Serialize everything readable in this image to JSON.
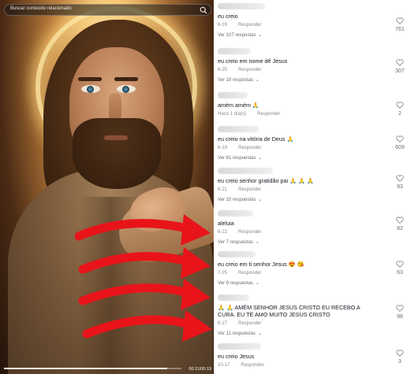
{
  "search": {
    "placeholder": "Buscar conteúdo relacionado"
  },
  "video": {
    "time": "00:11/00:19",
    "progress_fraction": 0.92
  },
  "comments": [
    {
      "text": "eu creio",
      "date": "6-19",
      "reply": "Responder",
      "likes": "761",
      "views": "Ver 107 respostas"
    },
    {
      "text": "eu creio em nome dê Jesus",
      "date": "6-25",
      "reply": "Responder",
      "likes": "307",
      "views": "Ver 18 respostas"
    },
    {
      "text": "amém amém 🙏",
      "date": "Hace 1 día(s)",
      "reply": "Responder",
      "likes": "2",
      "views": ""
    },
    {
      "text": "eu creio na vitória de Deus 🙏",
      "date": "6-19",
      "reply": "Responder",
      "likes": "609",
      "views": "Ver 61 respuestas"
    },
    {
      "text": "eu creio senhor gratidão pai 🙏 🙏 🙏",
      "date": "6-21",
      "reply": "Responder",
      "likes": "93",
      "views": "Ver 10 respuestas"
    },
    {
      "text": "aleluia",
      "date": "6-22",
      "reply": "Responder",
      "likes": "82",
      "views": "Ver 7 respuestas"
    },
    {
      "text": "eu creio em ti senhor Jesus 😍 😘",
      "date": "7-25",
      "reply": "Responder",
      "likes": "63",
      "views": "Ver 9 respuestas"
    },
    {
      "text": "🙏 🙏 AMÉM SENHOR JESUS CRISTO EU RECEBO A CURA. EU TE AMO MUITO JESUS CRISTO",
      "date": "6-17",
      "reply": "Responder",
      "likes": "98",
      "views": "Ver 11 respuestas"
    },
    {
      "text": "eu creio Jesus",
      "date": "10-17",
      "reply": "Responder",
      "likes": "3",
      "views": ""
    }
  ],
  "icons": {
    "search": "search-icon",
    "like": "heart-outline-icon",
    "expand": "chevron-down-icon"
  },
  "colors": {
    "text": "#161823",
    "meta": "#8a8a8a",
    "arrows": "#e8141a"
  }
}
